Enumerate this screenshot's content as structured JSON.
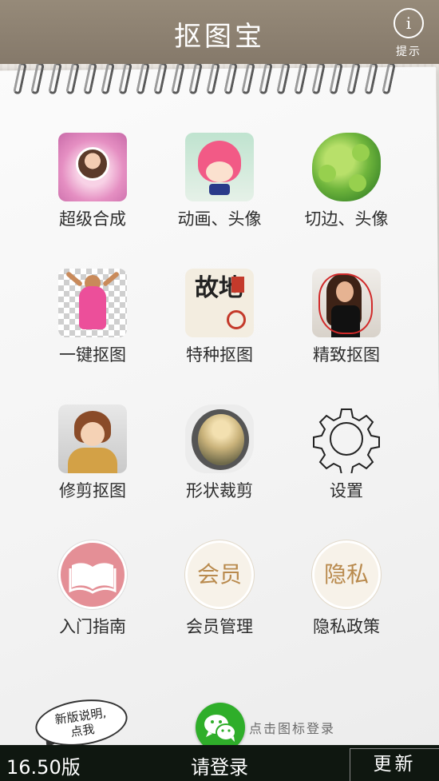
{
  "header": {
    "title": "抠图宝",
    "hint_icon": "i",
    "hint_label": "提示"
  },
  "grid": [
    {
      "label": "超级合成",
      "icon": "heart-portrait-icon"
    },
    {
      "label": "动画、头像",
      "icon": "cartoon-avatar-icon"
    },
    {
      "label": "切边、头像",
      "icon": "leaves-icon"
    },
    {
      "label": "一键抠图",
      "icon": "child-cutout-icon"
    },
    {
      "label": "特种抠图",
      "icon": "calligraphy-icon"
    },
    {
      "label": "精致抠图",
      "icon": "woman-outline-icon"
    },
    {
      "label": "修剪抠图",
      "icon": "anime-character-icon"
    },
    {
      "label": "形状裁剪",
      "icon": "shape-crop-icon"
    },
    {
      "label": "设置",
      "icon": "gear-icon"
    },
    {
      "label": "入门指南",
      "icon": "book-icon"
    },
    {
      "label": "会员管理",
      "icon_text": "会员"
    },
    {
      "label": "隐私政策",
      "icon_text": "隐私"
    }
  ],
  "calligraphy_text": "故地",
  "login": {
    "bubble_text": "新版说明,点我",
    "hint": "点击图标登录"
  },
  "footer": {
    "version": "16.50版",
    "login_label": "请登录",
    "update_label": "更新"
  },
  "colors": {
    "header": "#8b7f6f",
    "footer": "#0f1710",
    "wechat": "#2fae2a",
    "guide": "#e48f96",
    "accent_text": "#b98a4d"
  }
}
